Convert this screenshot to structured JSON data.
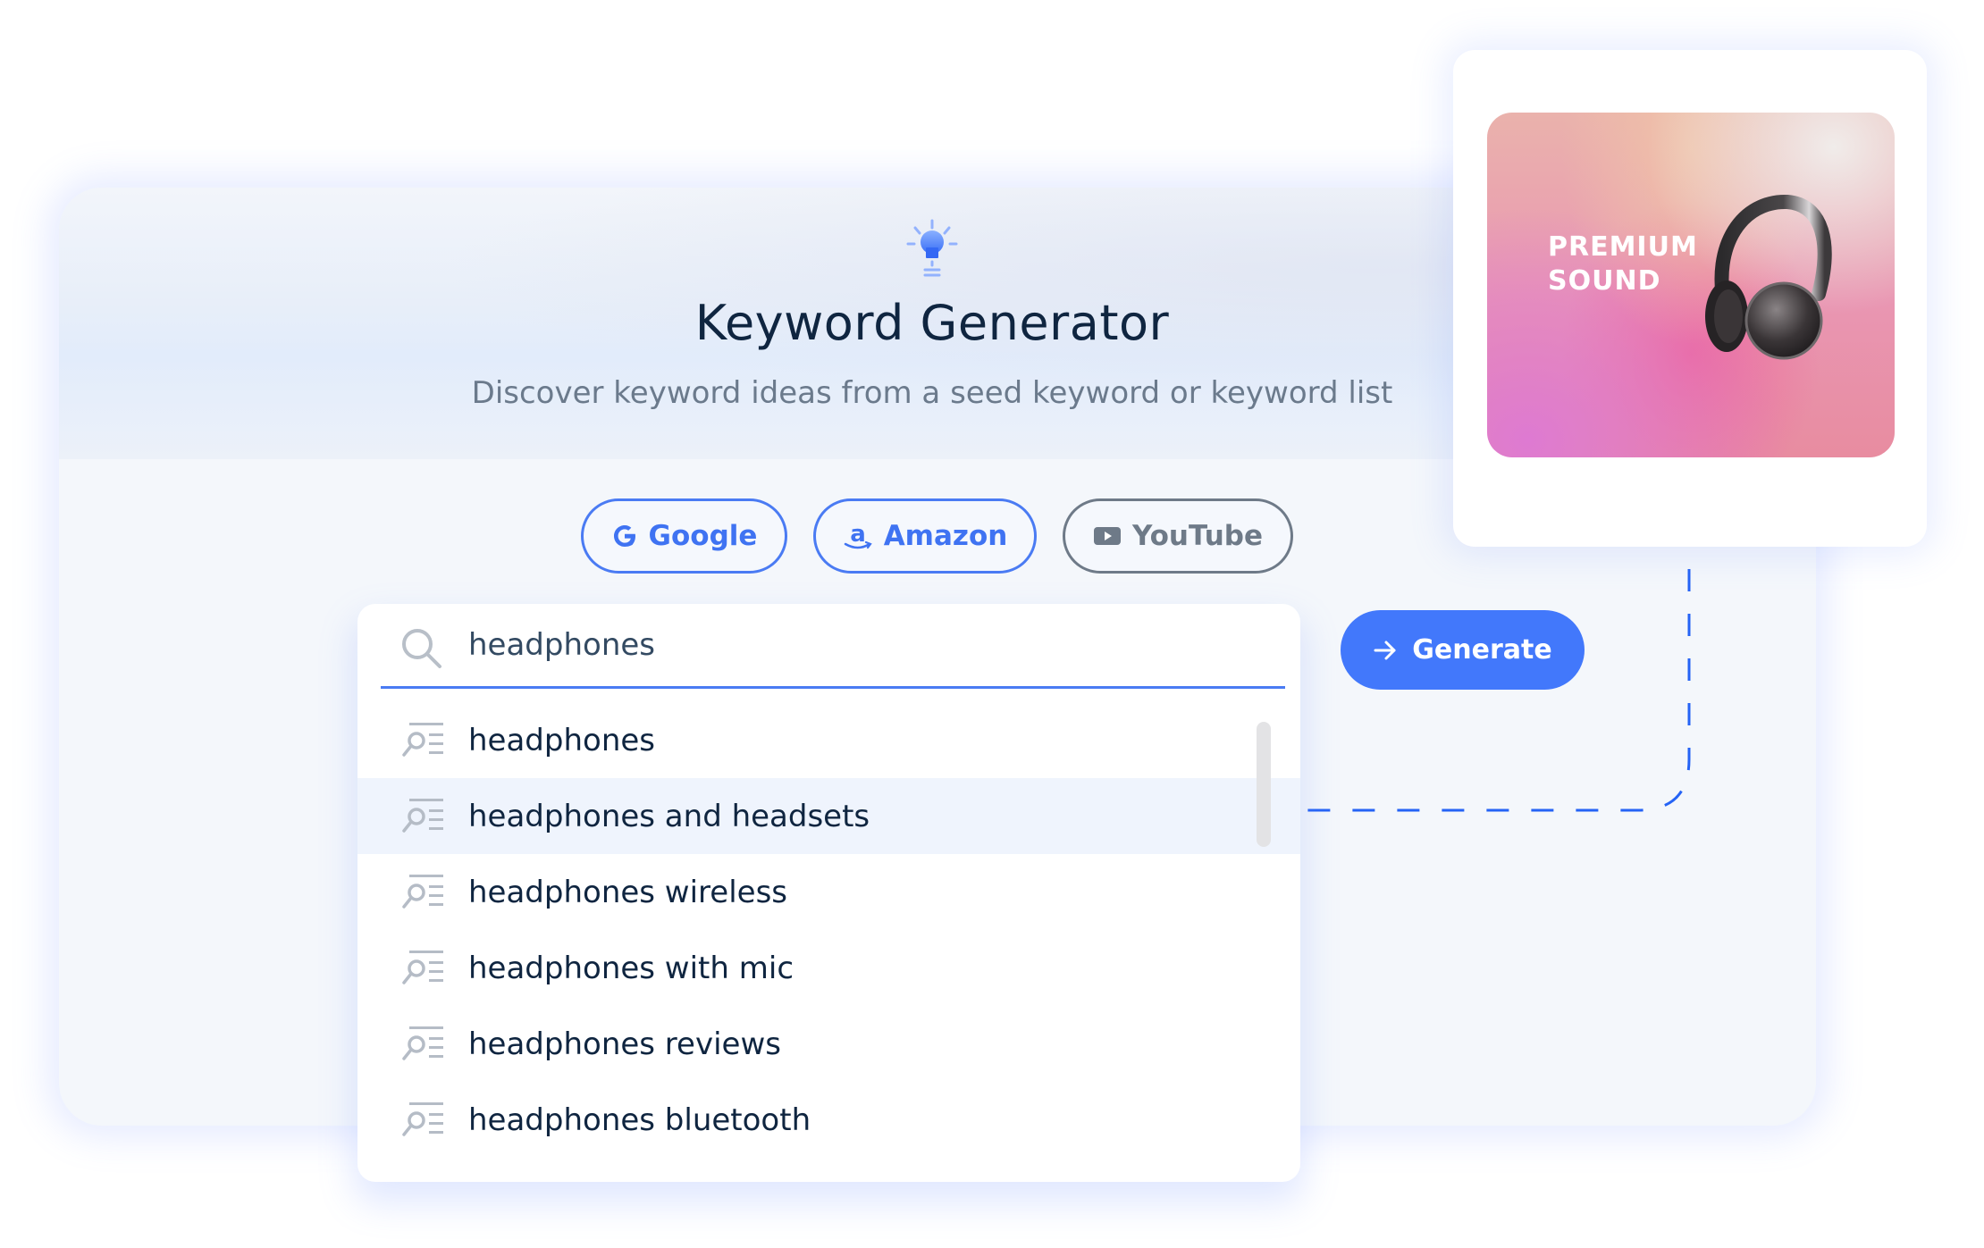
{
  "header": {
    "icon": "lightbulb-icon",
    "title": "Keyword Generator",
    "subtitle": "Discover keyword ideas from a seed keyword or keyword list"
  },
  "sources": [
    {
      "label": "Google",
      "icon": "google-icon",
      "selected": true
    },
    {
      "label": "Amazon",
      "icon": "amazon-icon",
      "selected": true
    },
    {
      "label": "YouTube",
      "icon": "youtube-icon",
      "selected": false
    }
  ],
  "search": {
    "icon": "search-icon",
    "value": "headphones",
    "placeholder": ""
  },
  "suggestions": [
    {
      "label": "headphones",
      "icon": "keyword-search-icon",
      "highlighted": false
    },
    {
      "label": "headphones and headsets",
      "icon": "keyword-search-icon",
      "highlighted": true
    },
    {
      "label": "headphones wireless",
      "icon": "keyword-search-icon",
      "highlighted": false
    },
    {
      "label": "headphones with mic",
      "icon": "keyword-search-icon",
      "highlighted": false
    },
    {
      "label": "headphones reviews",
      "icon": "keyword-search-icon",
      "highlighted": false
    },
    {
      "label": "headphones bluetooth",
      "icon": "keyword-search-icon",
      "highlighted": false
    }
  ],
  "generate": {
    "label": "Generate",
    "icon": "arrow-right-icon"
  },
  "promo": {
    "line1": "PREMIUM",
    "line2": "SOUND",
    "image": "headphones-product-image"
  },
  "colors": {
    "accent": "#4278fb",
    "title": "#0f2540",
    "subtitle": "#6b7a8c",
    "inactive": "#6e7a88",
    "highlight_row": "#eff4fd"
  }
}
